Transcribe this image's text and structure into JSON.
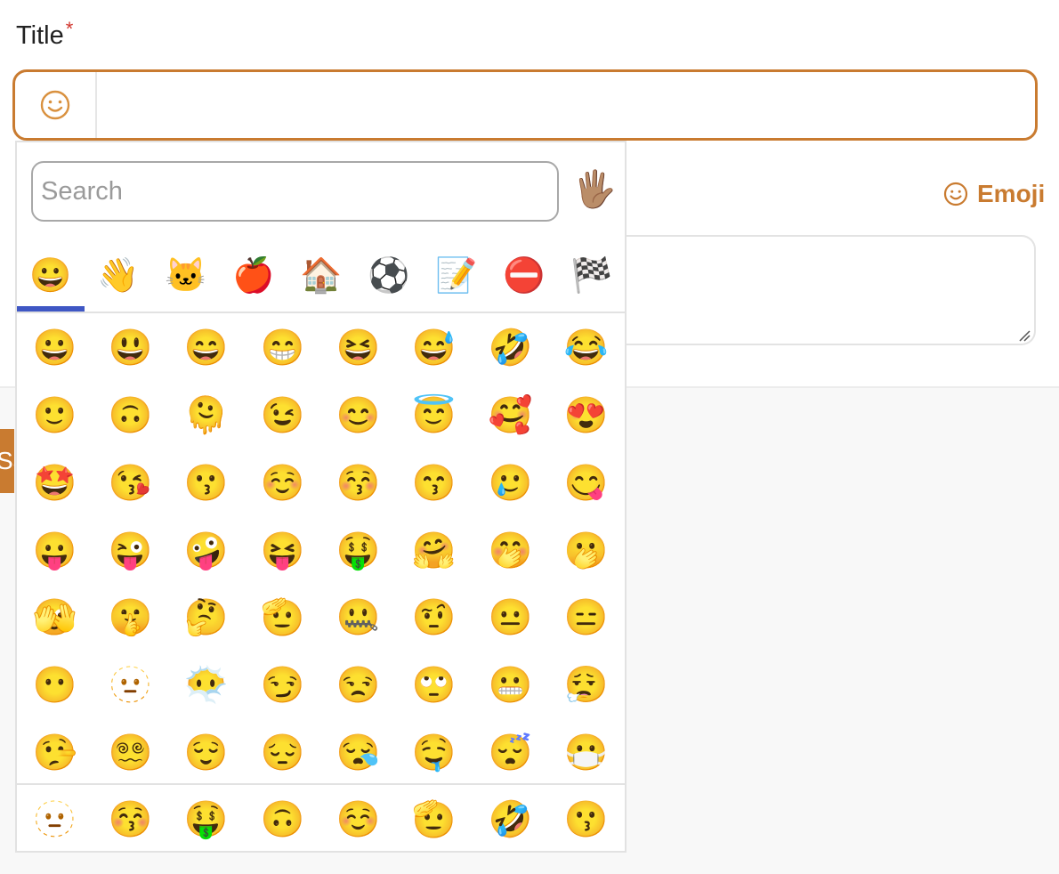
{
  "form": {
    "title_label": "Title",
    "required_mark": "*",
    "title_value": "",
    "title_emoji_icon": "smile-icon",
    "emoji_toggle_label": "Emoji",
    "save_fragment": "Sa",
    "accent_color": "#c97b30"
  },
  "picker": {
    "search_placeholder": "Search",
    "skin_tone": "🖐🏽",
    "active_category_index": 0,
    "categories": [
      {
        "name": "Smileys & People",
        "glyph": "😀"
      },
      {
        "name": "Animals & Nature",
        "glyph": "👋"
      },
      {
        "name": "Animals",
        "glyph": "🐱"
      },
      {
        "name": "Food & Drink",
        "glyph": "🍎"
      },
      {
        "name": "Travel & Places",
        "glyph": "🏠"
      },
      {
        "name": "Activities",
        "glyph": "⚽"
      },
      {
        "name": "Objects",
        "glyph": "📝"
      },
      {
        "name": "Symbols",
        "glyph": "⛔"
      },
      {
        "name": "Flags",
        "glyph": "🏁"
      }
    ],
    "emoji_rows": [
      [
        "😀",
        "😃",
        "😄",
        "😁",
        "😆",
        "😅",
        "🤣",
        "😂"
      ],
      [
        "🙂",
        "🙃",
        "🫠",
        "😉",
        "😊",
        "😇",
        "🥰",
        "😍"
      ],
      [
        "🤩",
        "😘",
        "😗",
        "☺️",
        "😚",
        "😙",
        "🥲",
        "😋"
      ],
      [
        "😛",
        "😜",
        "🤪",
        "😝",
        "🤑",
        "🤗",
        "🤭",
        "🫢"
      ],
      [
        "🫣",
        "🤫",
        "🤔",
        "🫡",
        "🤐",
        "🤨",
        "😐",
        "😑"
      ],
      [
        "😶",
        "🫥",
        "😶‍🌫️",
        "😏",
        "😒",
        "🙄",
        "😬",
        "😮‍💨"
      ],
      [
        "🤥",
        "😵‍💫",
        "😌",
        "😔",
        "😪",
        "🤤",
        "😴",
        "😷"
      ]
    ],
    "recent": [
      "🫥",
      "😚",
      "🤑",
      "🙃",
      "☺️",
      "🫡",
      "🤣",
      "😗"
    ]
  }
}
